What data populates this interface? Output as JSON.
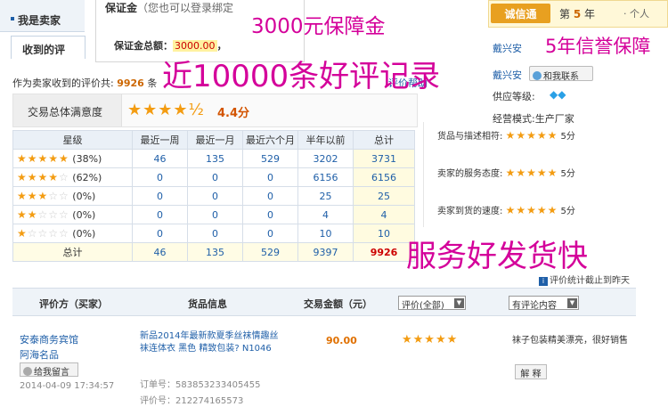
{
  "nav": {
    "title": "我是卖家",
    "tab": "收到的评"
  },
  "margin": {
    "header_label": "保证金",
    "header_note": "（您也可以登录绑定",
    "total_label": "保证金总额：",
    "total_value": "3000.00",
    "total_tail": "，"
  },
  "overlays": {
    "margin_claim": "3000元保障金",
    "reviews_claim": "近10000条好评记录",
    "credit_claim": "5年信誉保障",
    "service_claim": "服务好发货快"
  },
  "received": {
    "label": "作为卖家收到的评价共:",
    "count": "9926",
    "unit": "条",
    "help": "评价帮助"
  },
  "satisfaction": {
    "label": "交易总体满意度",
    "stars": "★★★★½",
    "score": "4.4分"
  },
  "rating_table": {
    "headers": [
      "星级",
      "最近一周",
      "最近一月",
      "最近六个月",
      "半年以前",
      "总计"
    ],
    "rows": [
      {
        "stars": "★★★★★",
        "empty": "",
        "pct": "(38%)",
        "week": "46",
        "month": "135",
        "six": "529",
        "older": "3202",
        "total": "3731"
      },
      {
        "stars": "★★★★",
        "empty": "☆",
        "pct": "(62%)",
        "week": "0",
        "month": "0",
        "six": "0",
        "older": "6156",
        "total": "6156"
      },
      {
        "stars": "★★★",
        "empty": "☆☆",
        "pct": "(0%)",
        "week": "0",
        "month": "0",
        "six": "0",
        "older": "25",
        "total": "25"
      },
      {
        "stars": "★★",
        "empty": "☆☆☆",
        "pct": "(0%)",
        "week": "0",
        "month": "0",
        "six": "0",
        "older": "4",
        "total": "4"
      },
      {
        "stars": "★",
        "empty": "☆☆☆☆",
        "pct": "(0%)",
        "week": "0",
        "month": "0",
        "six": "0",
        "older": "10",
        "total": "10"
      }
    ],
    "sum": {
      "label": "总计",
      "week": "46",
      "month": "135",
      "six": "529",
      "older": "9397",
      "total": "9926"
    }
  },
  "shop": {
    "badge": "诚信通",
    "year_pre": "第",
    "year": "5",
    "year_post": "年",
    "personal": "· 个人",
    "seller": "戴兴安",
    "contact": "和我联系",
    "supply_label": "供应等级:",
    "supply_icon": "◆◆",
    "mode_label": "经营模式:",
    "mode_value": "生产厂家"
  },
  "scores": [
    {
      "label": "货品与描述相符:",
      "stars": "★★★★★",
      "score": "5分"
    },
    {
      "label": "卖家的服务态度:",
      "stars": "★★★★★",
      "score": "5分"
    },
    {
      "label": "卖家到货的速度:",
      "stars": "★★★★★",
      "score": "5分"
    }
  ],
  "note": {
    "icon": "i",
    "text": "评价统计截止到昨天"
  },
  "list": {
    "col_rater": "评价方（买家）",
    "col_item": "货品信息",
    "col_amount": "交易金额（元）",
    "filter_rating": "评价(全部)",
    "filter_content": "有评论内容",
    "review": {
      "buyer": "安泰商务宾馆",
      "shop": "阿海名品",
      "message_btn": "给我留言",
      "date": "2014-04-09 17:34:57",
      "item_title": "新品2014年最新款夏季丝袜情趣丝袜连体衣 黑色 精致包装? N1046",
      "order_label": "订单号：",
      "order_no": "583853233405455",
      "review_label": "评价号：",
      "review_no": "212274165573",
      "amount": "90.00",
      "stars": "★★★★★",
      "comment": "袜子包装精美漂亮，很好销售",
      "explain_btn": "解 释"
    }
  }
}
